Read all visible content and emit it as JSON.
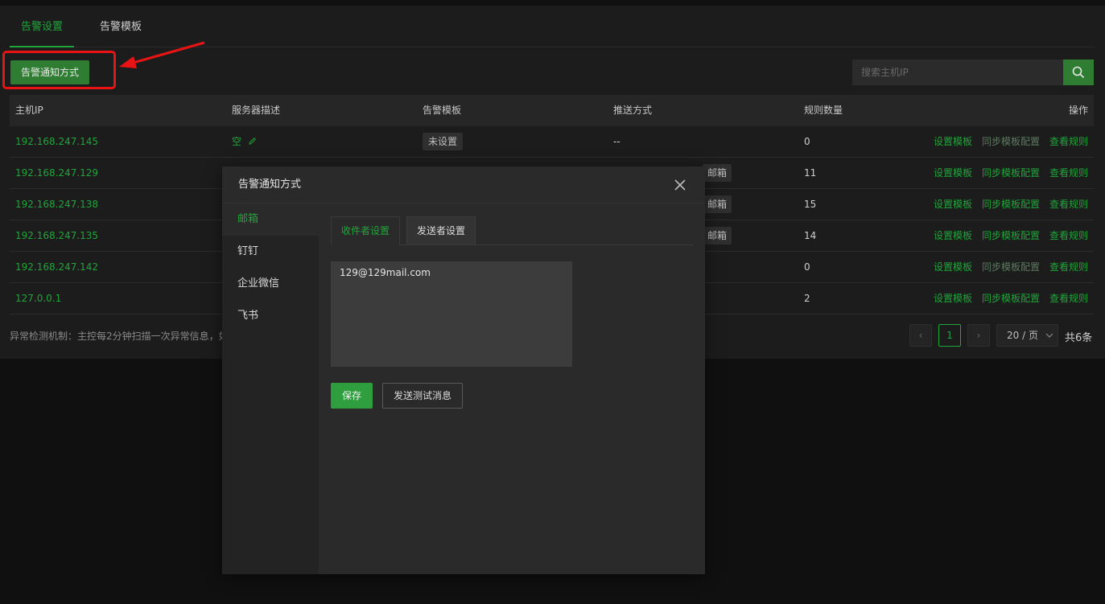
{
  "tabs": [
    "告警设置",
    "告警模板"
  ],
  "notify_button": "告警通知方式",
  "search": {
    "placeholder": "搜索主机IP"
  },
  "table": {
    "headers": [
      "主机IP",
      "服务器描述",
      "告警模板",
      "推送方式",
      "规则数量",
      "操作"
    ],
    "rows": [
      {
        "ip": "192.168.247.145",
        "desc": "空",
        "template": "未设置",
        "push": "--",
        "mail": "",
        "count": "0"
      },
      {
        "ip": "192.168.247.129",
        "desc": "",
        "template": "",
        "push": "",
        "mail": "邮箱",
        "count": "11"
      },
      {
        "ip": "192.168.247.138",
        "desc": "",
        "template": "",
        "push": "",
        "mail": "邮箱",
        "count": "15"
      },
      {
        "ip": "192.168.247.135",
        "desc": "",
        "template": "",
        "push": "",
        "mail": "邮箱",
        "count": "14"
      },
      {
        "ip": "192.168.247.142",
        "desc": "",
        "template": "",
        "push": "",
        "mail": "",
        "count": "0"
      },
      {
        "ip": "127.0.0.1",
        "desc": "",
        "template": "",
        "push": "",
        "mail": "",
        "count": "2"
      }
    ],
    "ops": [
      "设置模板",
      "同步模板配置",
      "查看规则"
    ]
  },
  "footer_note": "异常检测机制：主控每2分钟扫描一次异常信息，如",
  "pagination": {
    "current": "1",
    "page_size": "20 / 页",
    "total": "共6条"
  },
  "modal": {
    "title": "告警通知方式",
    "channels": [
      "邮箱",
      "钉钉",
      "企业微信",
      "飞书"
    ],
    "subtabs": [
      "收件者设置",
      "发送者设置"
    ],
    "recipients": "129@129mail.com",
    "save": "保存",
    "test": "发送测试消息"
  }
}
